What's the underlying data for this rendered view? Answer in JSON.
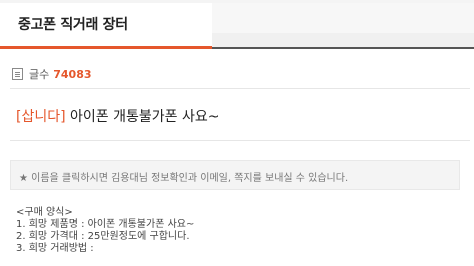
{
  "tab": {
    "title": "중고폰 직거래 장터"
  },
  "post_count": {
    "label": "글수",
    "value": "74083"
  },
  "post": {
    "tag": "[삽니다]",
    "title": "아이폰 개통불가폰 사요~"
  },
  "notice": "★ 이름을 클릭하시면 김용대님 정보확인과 이메일, 쪽지를 보내실 수 있습니다.",
  "body_lines": [
    "<구매 양식>",
    "1. 희망 제품명 : 아이폰 개통불가폰 사요~",
    "2. 희망 가격대 : 25만원정도에 구합니다.",
    "3. 희망 거래방법 :"
  ]
}
